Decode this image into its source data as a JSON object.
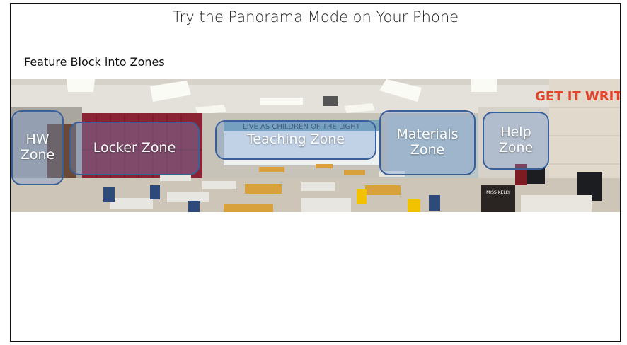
{
  "slide": {
    "title": "Try the Panorama Mode on Your Phone",
    "subtitle": "Feature Block into Zones"
  },
  "panorama": {
    "banner_text": "LIVE AS CHILDREN OF THE LIGHT",
    "wall_sign": "GET IT WRITE",
    "desk_sign": "MISS KELLY",
    "zones": [
      {
        "id": "hw",
        "label": "HW\nZone"
      },
      {
        "id": "locker",
        "label": "Locker Zone"
      },
      {
        "id": "teaching",
        "label": "Teaching Zone"
      },
      {
        "id": "materials",
        "label": "Materials\nZone"
      },
      {
        "id": "help",
        "label": "Help\nZone"
      }
    ]
  },
  "colors": {
    "zone_fill": "#6e96d2",
    "zone_border": "#3a5f9a",
    "lockers": "#8a2434",
    "desk_top": "#d9a13c",
    "chair": "#2e4a7a"
  }
}
